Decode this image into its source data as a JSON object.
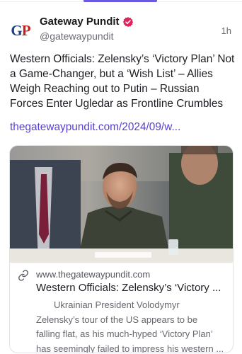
{
  "post": {
    "author": {
      "name": "Gateway Pundit",
      "handle": "@gatewaypundit",
      "avatar_logo": "GP",
      "verified": true
    },
    "timestamp": "1h",
    "text": "Western Officials: Zelensky’s ‘Victory Plan’ Not a Game-Changer, but a ‘Wish List’ – Allies Weigh Reaching out to Putin – Russian Forces Enter Ugledar as Frontline Crumbles",
    "link": "thegatewaypundit.com/2024/09/w...",
    "card": {
      "domain": "www.thegatewaypundit.com",
      "title": "Western Officials: Zelensky’s ‘Victory ...",
      "description": [
        "Ukrainian President Volodymyr",
        "Zelensky’s tour of the US appears to be",
        "falling flat, as his much-hyped ‘Victory Plan’",
        "has seemingly failed to impress his western ..."
      ],
      "link_icon": "link-icon"
    }
  },
  "colors": {
    "accent": "#6a5ae0",
    "link": "#5a3fd0",
    "verified_badge": "#e0245e",
    "logo_blue": "#1d3f86",
    "logo_red": "#c8201e"
  }
}
